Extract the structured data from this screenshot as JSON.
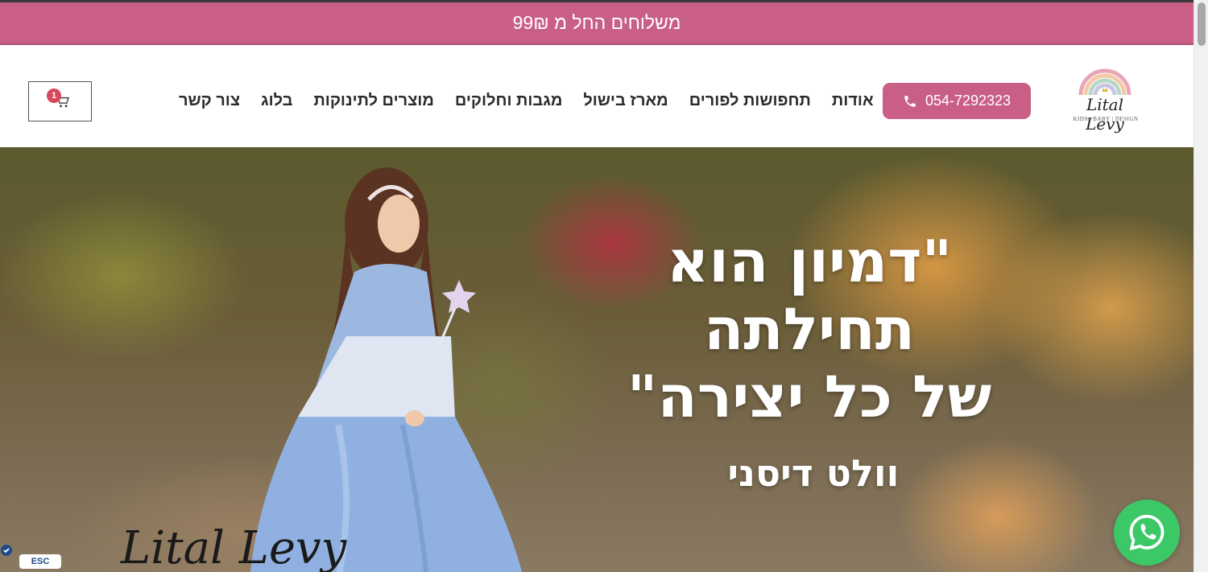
{
  "promo_bar": {
    "text": "משלוחים החל מ 99₪"
  },
  "header": {
    "logo": {
      "name": "Lital Levy",
      "tagline": "KIDS | BABY | DESIGN"
    },
    "phone_button": {
      "label": "054-7292323",
      "icon": "phone-icon"
    },
    "nav": [
      {
        "label": "אודות"
      },
      {
        "label": "תחפושות לפורים"
      },
      {
        "label": "מארז בישול"
      },
      {
        "label": "מגבות וחלוקים"
      },
      {
        "label": "מוצרים לתינוקות"
      },
      {
        "label": "בלוג"
      },
      {
        "label": "צור קשר"
      }
    ],
    "cart": {
      "count": "1",
      "icon": "cart-icon"
    }
  },
  "hero": {
    "quote_lines": [
      "\"דמיון הוא",
      "תחילתה",
      "של כל יצירה\""
    ],
    "author": "וולט דיסני",
    "signature": "Lital Levy"
  },
  "widgets": {
    "esc_label": "ESC",
    "whatsapp_icon": "whatsapp-icon",
    "accessibility_icon": "accessibility-icon"
  },
  "colors": {
    "brand_pink": "#c95f87",
    "whatsapp_green": "#3cc866",
    "badge_red": "#d9475a"
  }
}
